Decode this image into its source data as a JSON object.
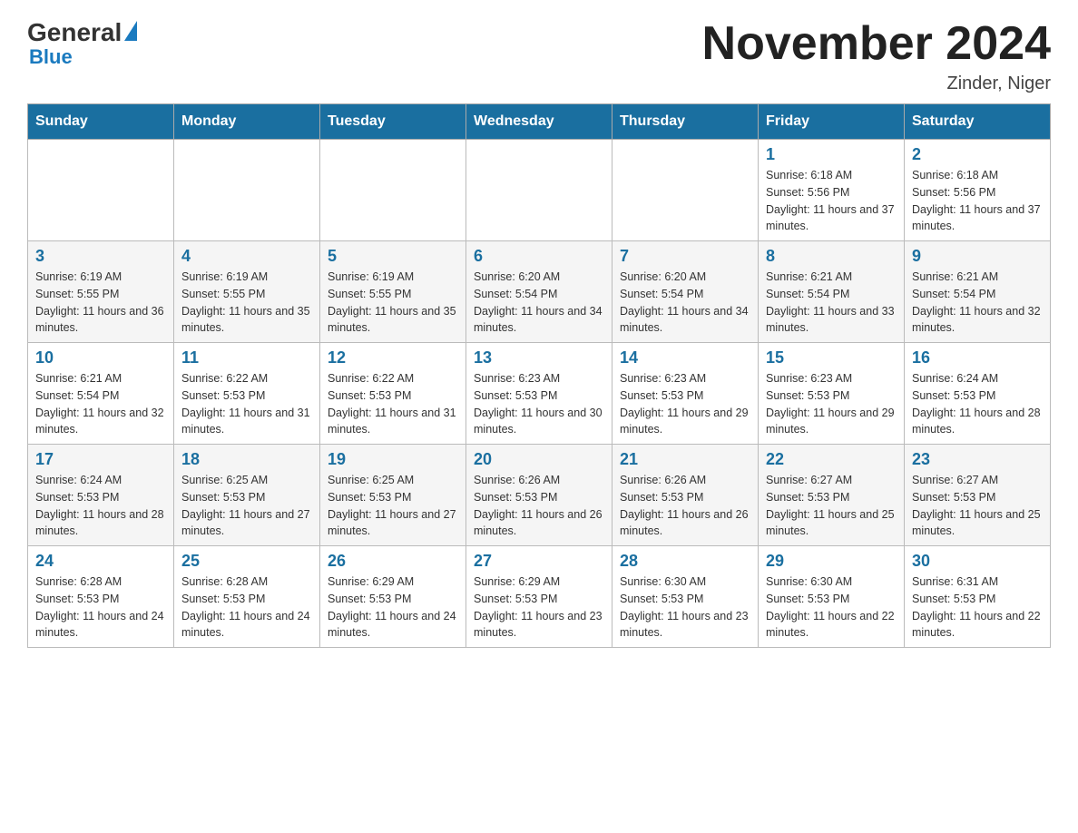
{
  "header": {
    "logo_general": "General",
    "logo_blue": "Blue",
    "month_title": "November 2024",
    "location": "Zinder, Niger"
  },
  "days_of_week": [
    "Sunday",
    "Monday",
    "Tuesday",
    "Wednesday",
    "Thursday",
    "Friday",
    "Saturday"
  ],
  "weeks": [
    {
      "days": [
        {
          "number": "",
          "info": ""
        },
        {
          "number": "",
          "info": ""
        },
        {
          "number": "",
          "info": ""
        },
        {
          "number": "",
          "info": ""
        },
        {
          "number": "",
          "info": ""
        },
        {
          "number": "1",
          "info": "Sunrise: 6:18 AM\nSunset: 5:56 PM\nDaylight: 11 hours and 37 minutes."
        },
        {
          "number": "2",
          "info": "Sunrise: 6:18 AM\nSunset: 5:56 PM\nDaylight: 11 hours and 37 minutes."
        }
      ]
    },
    {
      "days": [
        {
          "number": "3",
          "info": "Sunrise: 6:19 AM\nSunset: 5:55 PM\nDaylight: 11 hours and 36 minutes."
        },
        {
          "number": "4",
          "info": "Sunrise: 6:19 AM\nSunset: 5:55 PM\nDaylight: 11 hours and 35 minutes."
        },
        {
          "number": "5",
          "info": "Sunrise: 6:19 AM\nSunset: 5:55 PM\nDaylight: 11 hours and 35 minutes."
        },
        {
          "number": "6",
          "info": "Sunrise: 6:20 AM\nSunset: 5:54 PM\nDaylight: 11 hours and 34 minutes."
        },
        {
          "number": "7",
          "info": "Sunrise: 6:20 AM\nSunset: 5:54 PM\nDaylight: 11 hours and 34 minutes."
        },
        {
          "number": "8",
          "info": "Sunrise: 6:21 AM\nSunset: 5:54 PM\nDaylight: 11 hours and 33 minutes."
        },
        {
          "number": "9",
          "info": "Sunrise: 6:21 AM\nSunset: 5:54 PM\nDaylight: 11 hours and 32 minutes."
        }
      ]
    },
    {
      "days": [
        {
          "number": "10",
          "info": "Sunrise: 6:21 AM\nSunset: 5:54 PM\nDaylight: 11 hours and 32 minutes."
        },
        {
          "number": "11",
          "info": "Sunrise: 6:22 AM\nSunset: 5:53 PM\nDaylight: 11 hours and 31 minutes."
        },
        {
          "number": "12",
          "info": "Sunrise: 6:22 AM\nSunset: 5:53 PM\nDaylight: 11 hours and 31 minutes."
        },
        {
          "number": "13",
          "info": "Sunrise: 6:23 AM\nSunset: 5:53 PM\nDaylight: 11 hours and 30 minutes."
        },
        {
          "number": "14",
          "info": "Sunrise: 6:23 AM\nSunset: 5:53 PM\nDaylight: 11 hours and 29 minutes."
        },
        {
          "number": "15",
          "info": "Sunrise: 6:23 AM\nSunset: 5:53 PM\nDaylight: 11 hours and 29 minutes."
        },
        {
          "number": "16",
          "info": "Sunrise: 6:24 AM\nSunset: 5:53 PM\nDaylight: 11 hours and 28 minutes."
        }
      ]
    },
    {
      "days": [
        {
          "number": "17",
          "info": "Sunrise: 6:24 AM\nSunset: 5:53 PM\nDaylight: 11 hours and 28 minutes."
        },
        {
          "number": "18",
          "info": "Sunrise: 6:25 AM\nSunset: 5:53 PM\nDaylight: 11 hours and 27 minutes."
        },
        {
          "number": "19",
          "info": "Sunrise: 6:25 AM\nSunset: 5:53 PM\nDaylight: 11 hours and 27 minutes."
        },
        {
          "number": "20",
          "info": "Sunrise: 6:26 AM\nSunset: 5:53 PM\nDaylight: 11 hours and 26 minutes."
        },
        {
          "number": "21",
          "info": "Sunrise: 6:26 AM\nSunset: 5:53 PM\nDaylight: 11 hours and 26 minutes."
        },
        {
          "number": "22",
          "info": "Sunrise: 6:27 AM\nSunset: 5:53 PM\nDaylight: 11 hours and 25 minutes."
        },
        {
          "number": "23",
          "info": "Sunrise: 6:27 AM\nSunset: 5:53 PM\nDaylight: 11 hours and 25 minutes."
        }
      ]
    },
    {
      "days": [
        {
          "number": "24",
          "info": "Sunrise: 6:28 AM\nSunset: 5:53 PM\nDaylight: 11 hours and 24 minutes."
        },
        {
          "number": "25",
          "info": "Sunrise: 6:28 AM\nSunset: 5:53 PM\nDaylight: 11 hours and 24 minutes."
        },
        {
          "number": "26",
          "info": "Sunrise: 6:29 AM\nSunset: 5:53 PM\nDaylight: 11 hours and 24 minutes."
        },
        {
          "number": "27",
          "info": "Sunrise: 6:29 AM\nSunset: 5:53 PM\nDaylight: 11 hours and 23 minutes."
        },
        {
          "number": "28",
          "info": "Sunrise: 6:30 AM\nSunset: 5:53 PM\nDaylight: 11 hours and 23 minutes."
        },
        {
          "number": "29",
          "info": "Sunrise: 6:30 AM\nSunset: 5:53 PM\nDaylight: 11 hours and 22 minutes."
        },
        {
          "number": "30",
          "info": "Sunrise: 6:31 AM\nSunset: 5:53 PM\nDaylight: 11 hours and 22 minutes."
        }
      ]
    }
  ]
}
